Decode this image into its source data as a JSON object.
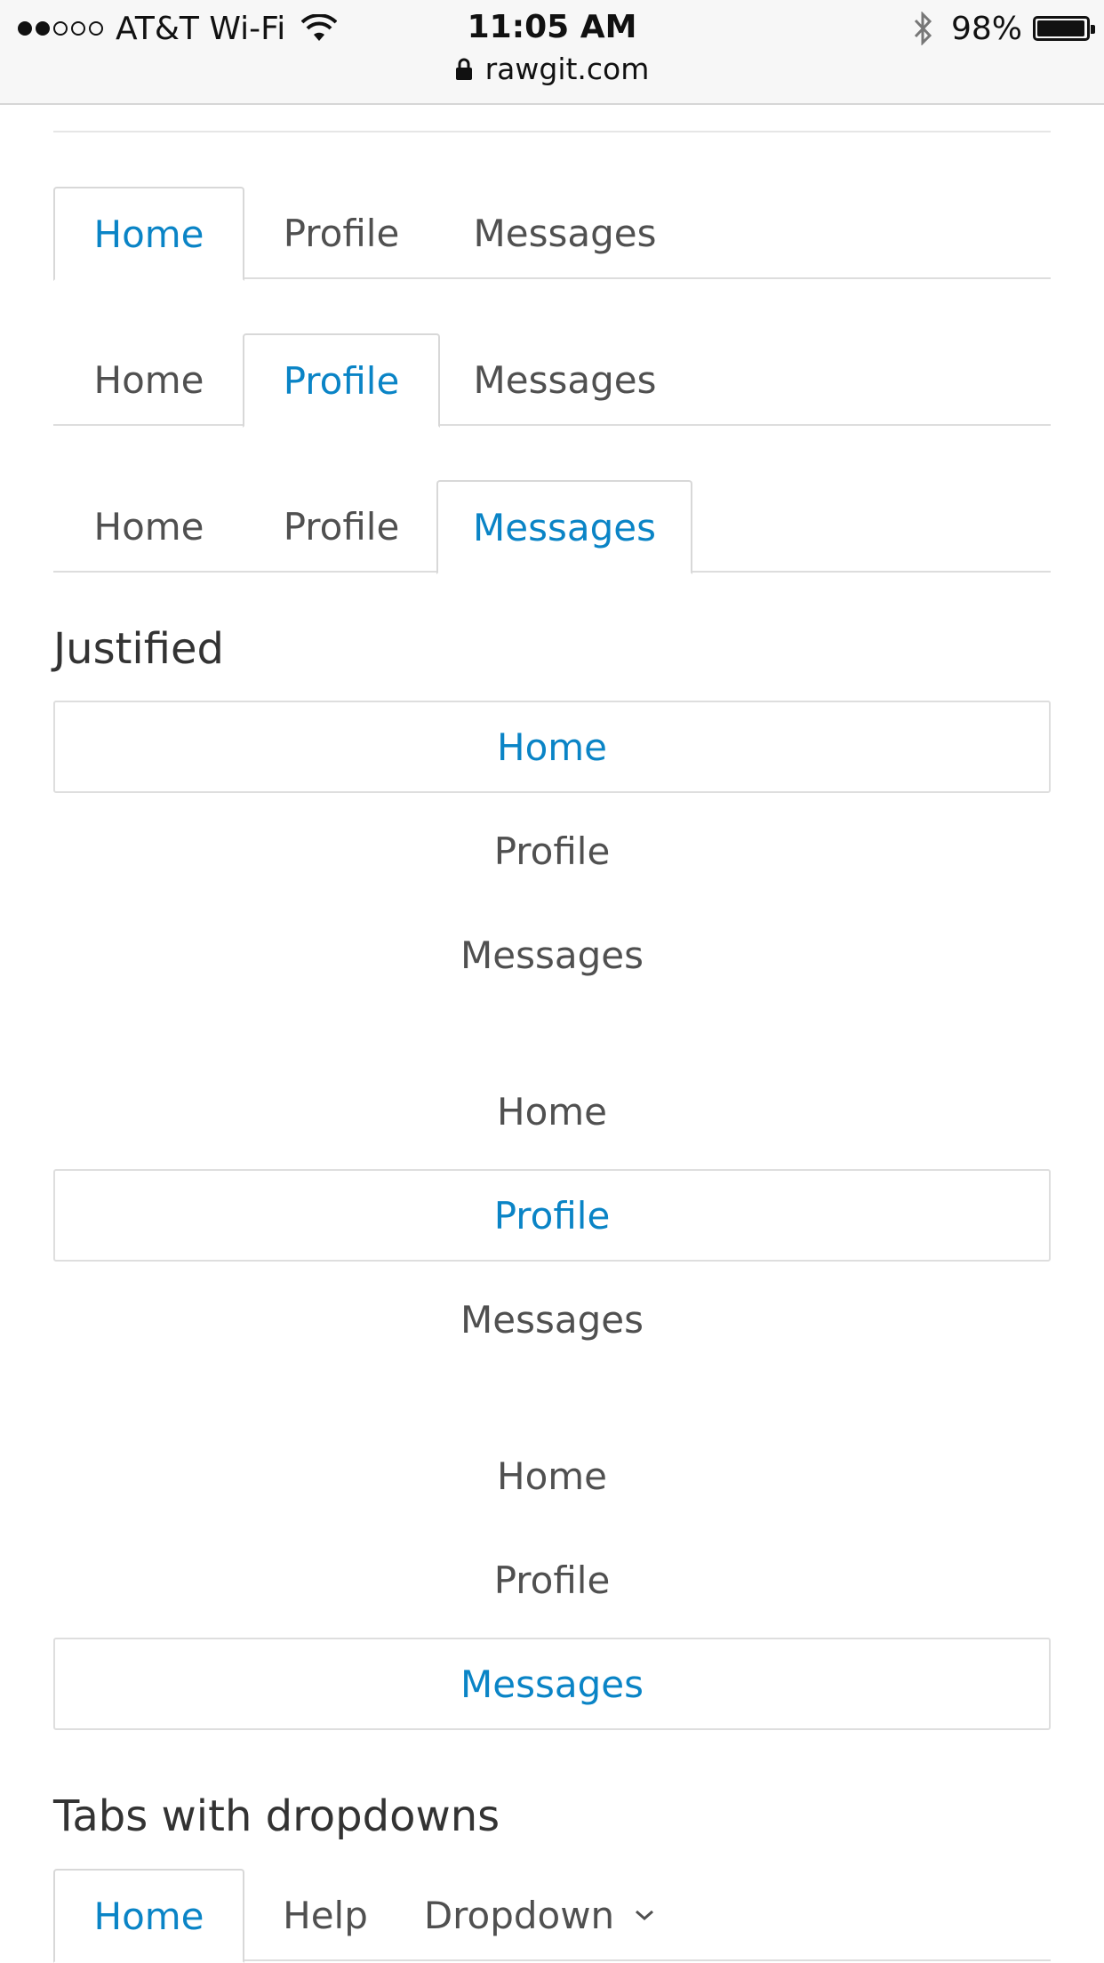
{
  "status_bar": {
    "carrier": "AT&T Wi-Fi",
    "time": "11:05 AM",
    "battery": "98%",
    "url": "rawgit.com"
  },
  "tab_groups": [
    {
      "tabs": [
        {
          "label": "Home",
          "active": true
        },
        {
          "label": "Profile",
          "active": false
        },
        {
          "label": "Messages",
          "active": false
        }
      ]
    },
    {
      "tabs": [
        {
          "label": "Home",
          "active": false
        },
        {
          "label": "Profile",
          "active": true
        },
        {
          "label": "Messages",
          "active": false
        }
      ]
    },
    {
      "tabs": [
        {
          "label": "Home",
          "active": false
        },
        {
          "label": "Profile",
          "active": false
        },
        {
          "label": "Messages",
          "active": true
        }
      ]
    }
  ],
  "justified": {
    "heading": "Justified",
    "groups": [
      {
        "items": [
          {
            "label": "Home",
            "active": true
          },
          {
            "label": "Profile",
            "active": false
          },
          {
            "label": "Messages",
            "active": false
          }
        ]
      },
      {
        "items": [
          {
            "label": "Home",
            "active": false
          },
          {
            "label": "Profile",
            "active": true
          },
          {
            "label": "Messages",
            "active": false
          }
        ]
      },
      {
        "items": [
          {
            "label": "Home",
            "active": false
          },
          {
            "label": "Profile",
            "active": false
          },
          {
            "label": "Messages",
            "active": true
          }
        ]
      }
    ]
  },
  "dropdown_tabs": {
    "heading": "Tabs with dropdowns",
    "tabs": [
      {
        "label": "Home",
        "active": true
      },
      {
        "label": "Help",
        "active": false
      },
      {
        "label": "Dropdown",
        "active": false
      }
    ]
  },
  "colors": {
    "accent": "#0a84c6",
    "text": "#505050",
    "border": "#dddddd"
  }
}
